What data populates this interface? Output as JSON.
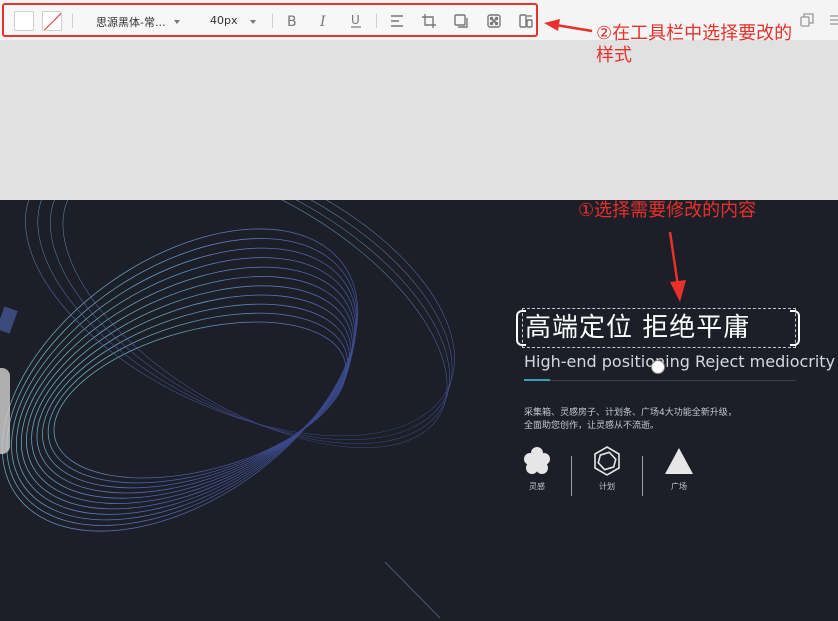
{
  "toolbar": {
    "font_family": "思源黑体-常...",
    "font_size": "40px",
    "fill_color": "#ffffff",
    "stroke_color": "none",
    "icons": [
      "fill-color",
      "stroke-color",
      "bold",
      "italic",
      "underline",
      "align",
      "crop",
      "shadow",
      "pattern",
      "arrange"
    ]
  },
  "annotations": {
    "step2": "②在工具栏中选择要改的样式",
    "step2_line1": "②在工具栏中选择要改的",
    "step2_line2": "样式",
    "step1": "①选择需要修改的内容"
  },
  "banner": {
    "title": "高端定位  拒绝平庸",
    "subtitle": "High-end positioning Reject mediocrity",
    "desc_line1": "采集箱、灵感房子、计划条、广场4大功能全新升级，",
    "desc_line2": "全面助您创作，让灵感从不流逝。",
    "features": [
      {
        "label": "灵感",
        "icon": "flower-icon"
      },
      {
        "label": "计划",
        "icon": "hexagon-icon"
      },
      {
        "label": "广场",
        "icon": "triangle-icon"
      }
    ]
  },
  "colors": {
    "accent": "#e8312b",
    "banner_bg": "#1c1f27"
  }
}
